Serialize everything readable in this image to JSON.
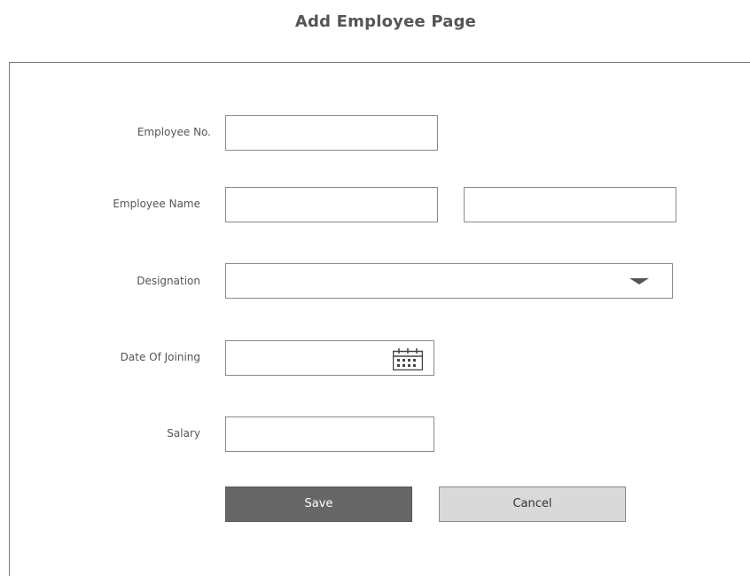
{
  "page": {
    "title": "Add Employee Page"
  },
  "form": {
    "employee_no": {
      "label": "Employee No.",
      "value": ""
    },
    "employee_name": {
      "label": "Employee Name",
      "first_value": "",
      "last_value": ""
    },
    "designation": {
      "label": "Designation",
      "selected": ""
    },
    "date_of_joining": {
      "label": "Date Of Joining",
      "value": ""
    },
    "salary": {
      "label": "Salary",
      "value": ""
    }
  },
  "actions": {
    "save_label": "Save",
    "cancel_label": "Cancel"
  },
  "icons": {
    "dropdown": "chevron-down-icon",
    "calendar": "calendar-icon"
  },
  "colors": {
    "save_button": "#666666",
    "cancel_button": "#d9d9d9",
    "border": "#8a8a8a"
  }
}
